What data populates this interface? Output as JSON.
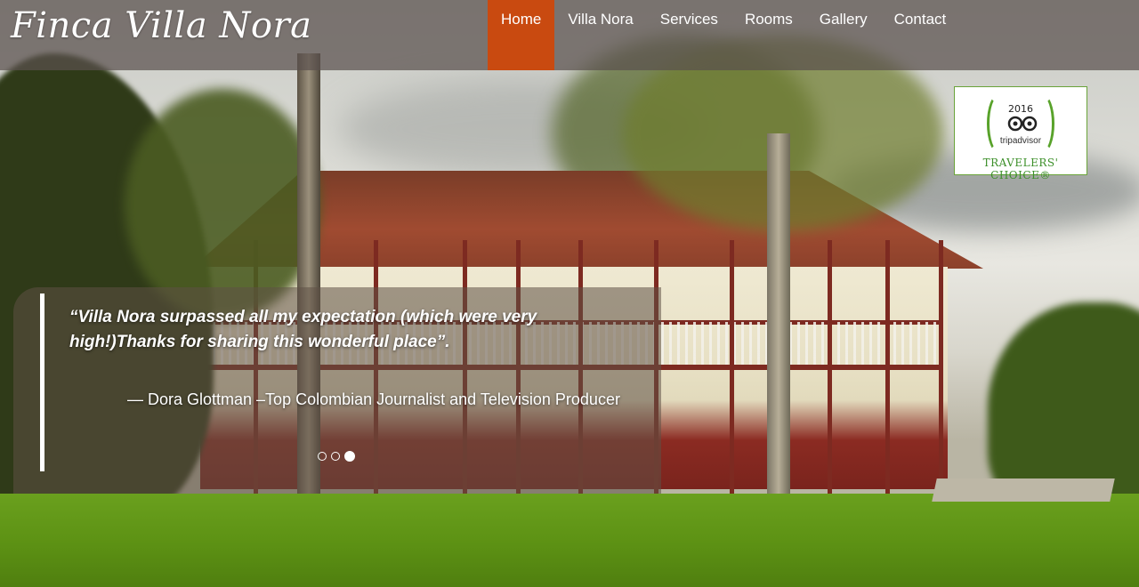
{
  "site": {
    "logo": "Finca Villa Nora"
  },
  "nav": {
    "items": [
      {
        "label": "Home",
        "active": true
      },
      {
        "label": "Villa Nora",
        "active": false
      },
      {
        "label": "Services",
        "active": false
      },
      {
        "label": "Rooms",
        "active": false
      },
      {
        "label": "Gallery",
        "active": false
      },
      {
        "label": "Contact",
        "active": false
      }
    ],
    "active_color": "#c94a10"
  },
  "badge": {
    "year": "2016",
    "brand": "tripadvisor",
    "label": "TRAVELERS' CHOICE®",
    "icon": "owl-icon"
  },
  "testimonial": {
    "quote": "“Villa Nora surpassed all my expectation (which were very high!)Thanks for sharing this wonderful place”.",
    "author": "— Dora Glottman –Top Colombian Journalist and Television Producer",
    "slides_total": 3,
    "active_slide": 3
  },
  "hero": {
    "image": "hacienda-house-photo"
  }
}
